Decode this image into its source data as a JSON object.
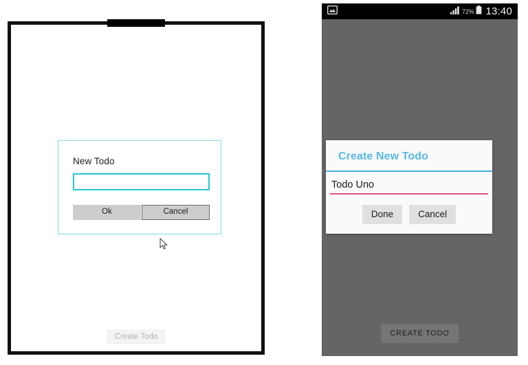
{
  "windows_panel": {
    "device_name": "tablet-emulator",
    "dialog": {
      "title": "New Todo",
      "input_value": "",
      "input_placeholder": "",
      "ok_label": "Ok",
      "cancel_label": "Cancel",
      "border_color": "#7fd9e4",
      "input_border_color": "#24c6d6",
      "hovered_button": "Cancel"
    },
    "create_todo_label": "Create Todo",
    "cursor_icon": "mouse-pointer-icon"
  },
  "android_panel": {
    "status_bar": {
      "left_icon": "gallery-image-icon",
      "signal_icon": "signal-bars-icon",
      "battery_percent": "72%",
      "battery_icon": "battery-icon",
      "clock": "13:40"
    },
    "dialog": {
      "title": "Create New Todo",
      "title_color": "#59b9e4",
      "title_rule_color": "#4ab4e0",
      "input_value": "Todo Uno",
      "input_underline_color": "#e0537d",
      "done_label": "Done",
      "cancel_label": "Cancel"
    },
    "create_todo_label": "CREATE TODO",
    "background_color": "#656565"
  }
}
